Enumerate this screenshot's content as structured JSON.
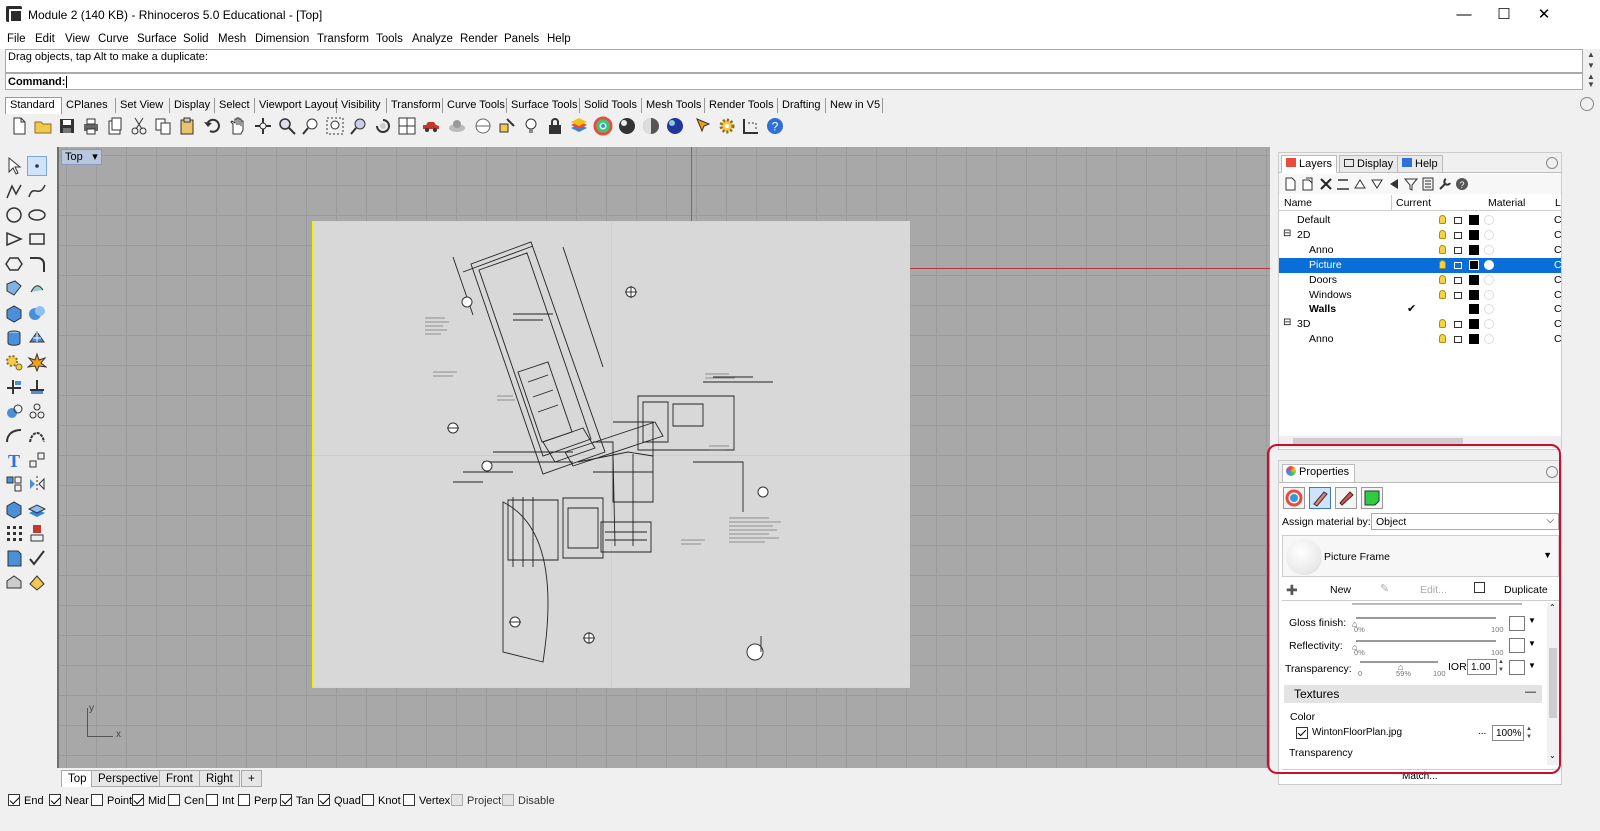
{
  "window": {
    "title": "Module 2 (140 KB) - Rhinoceros 5.0 Educational - [Top]",
    "min": "—",
    "max": "☐",
    "close": "✕"
  },
  "menu": [
    "File",
    "Edit",
    "View",
    "Curve",
    "Surface",
    "Solid",
    "Mesh",
    "Dimension",
    "Transform",
    "Tools",
    "Analyze",
    "Render",
    "Panels",
    "Help"
  ],
  "command": {
    "history": "Drag objects, tap Alt to make a duplicate:",
    "label": "Command:"
  },
  "toolbar_tabs": [
    "Standard",
    "CPlanes",
    "Set View",
    "Display",
    "Select",
    "Viewport Layout",
    "Visibility",
    "Transform",
    "Curve Tools",
    "Surface Tools",
    "Solid Tools",
    "Mesh Tools",
    "Render Tools",
    "Drafting",
    "New in V5"
  ],
  "viewport": {
    "label": "Top",
    "arrow": "▾",
    "axis_y": "y",
    "axis_x": "x"
  },
  "viewport_tabs": [
    "Top",
    "Perspective",
    "Front",
    "Right",
    "+"
  ],
  "osnaps": [
    {
      "label": "End",
      "on": true
    },
    {
      "label": "Near",
      "on": true
    },
    {
      "label": "Point",
      "on": false
    },
    {
      "label": "Mid",
      "on": true
    },
    {
      "label": "Cen",
      "on": false
    },
    {
      "label": "Int",
      "on": false
    },
    {
      "label": "Perp",
      "on": false
    },
    {
      "label": "Tan",
      "on": true
    },
    {
      "label": "Quad",
      "on": true
    },
    {
      "label": "Knot",
      "on": false
    },
    {
      "label": "Vertex",
      "on": false
    },
    {
      "label": "Project",
      "on": false
    },
    {
      "label": "Disable",
      "on": false
    }
  ],
  "layers": {
    "tabs": [
      "Layers",
      "Display",
      "Help"
    ],
    "headers": {
      "name": "Name",
      "current": "Current",
      "material": "Material",
      "l": "L"
    },
    "rows": [
      {
        "name": "Default",
        "exp": "",
        "check": "",
        "tail": "C"
      },
      {
        "name": "2D",
        "exp": "⊟",
        "check": "",
        "tail": "C"
      },
      {
        "name": "Anno",
        "exp": "",
        "check": "",
        "tail": "C"
      },
      {
        "name": "Picture",
        "exp": "",
        "check": "",
        "tail": "C",
        "selected": true
      },
      {
        "name": "Doors",
        "exp": "",
        "check": "",
        "tail": "C"
      },
      {
        "name": "Windows",
        "exp": "",
        "check": "",
        "tail": "C"
      },
      {
        "name": "Walls",
        "exp": "",
        "check": "✔",
        "tail": "C",
        "bold": true
      },
      {
        "name": "3D",
        "exp": "⊟",
        "check": "",
        "tail": "C"
      },
      {
        "name": "Anno",
        "exp": "",
        "check": "",
        "tail": "C"
      }
    ]
  },
  "properties": {
    "title": "Properties",
    "assign_label": "Assign material by:",
    "assign_value": "Object",
    "material_name": "Picture Frame",
    "new": "New",
    "edit": "Edit...",
    "duplicate": "Duplicate",
    "gloss_label": "Gloss finish:",
    "gloss_min": "0%",
    "gloss_max": "100",
    "reflect_label": "Reflectivity:",
    "reflect_min": "0%",
    "reflect_max": "100",
    "transp_label": "Transparency:",
    "transp_min": "0",
    "transp_val": "59%",
    "transp_max": "100",
    "ior_label": "IOR:",
    "ior_value": "1.00",
    "textures_title": "Textures",
    "textures_collapse": "—",
    "color_label": "Color",
    "texture_file": "WintonFloorPlan.jpg",
    "texture_more": "...",
    "texture_amount": "100%",
    "transparency_label": "Transparency",
    "match": "Match..."
  },
  "colors": {
    "accent": "#0a6ed8",
    "highlight": "#c8102e",
    "viewport_bg": "#a8a8a8",
    "picture_border": "#f0f000"
  }
}
